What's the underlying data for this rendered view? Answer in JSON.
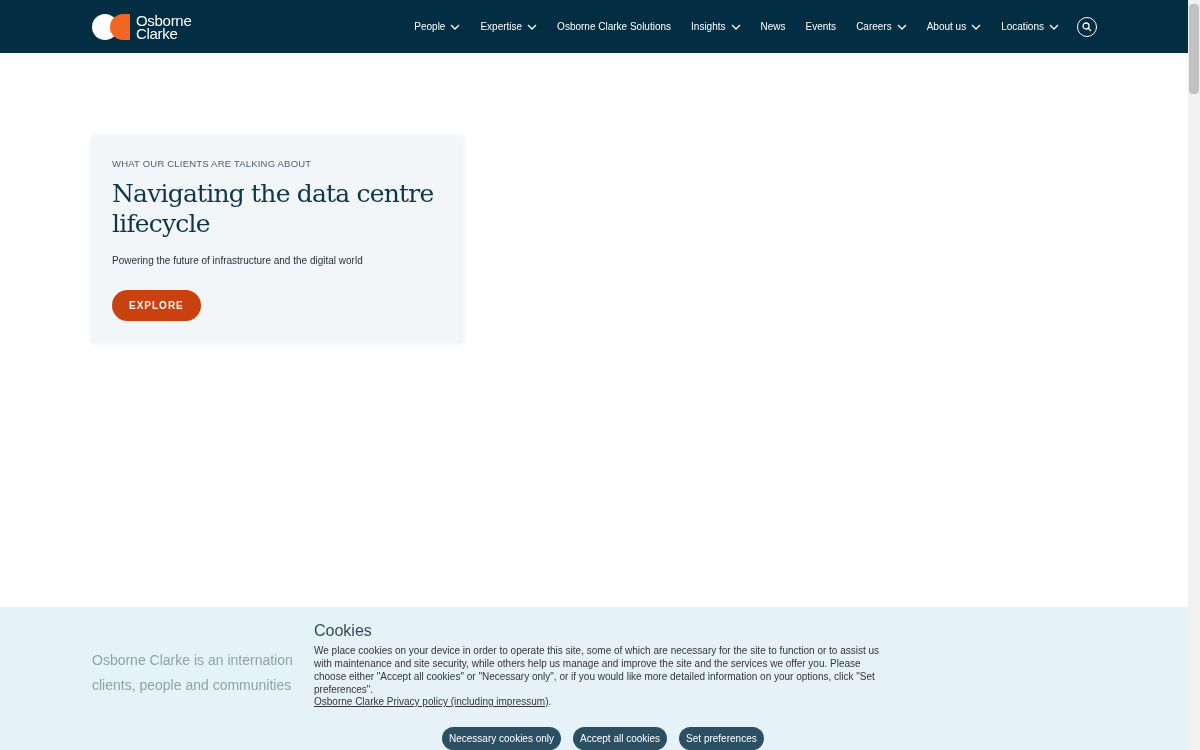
{
  "header": {
    "logo_text": [
      "Osborne",
      "Clarke"
    ],
    "nav": [
      {
        "label": "People",
        "dropdown": true
      },
      {
        "label": "Expertise",
        "dropdown": true
      },
      {
        "label": "Osborne Clarke Solutions",
        "dropdown": false
      },
      {
        "label": "Insights",
        "dropdown": true
      },
      {
        "label": "News",
        "dropdown": false
      },
      {
        "label": "Events",
        "dropdown": false
      },
      {
        "label": "Careers",
        "dropdown": true
      },
      {
        "label": "About us",
        "dropdown": true
      },
      {
        "label": "Locations",
        "dropdown": true
      }
    ]
  },
  "hero": {
    "eyebrow": "WHAT OUR CLIENTS ARE TALKING ABOUT",
    "title": "Navigating the data centre lifecycle",
    "subtitle": "Powering the future of infrastructure and the digital world",
    "button": "EXPLORE"
  },
  "intro_fragments": [
    "Osborne Clarke is an internation",
    "clients, people and communities"
  ],
  "cookie_banner": {
    "title": "Cookies",
    "text": "We place cookies on your device in order to operate this site, some of which are necessary for the site to function or to assist us with maintenance and site security, while others help us manage and improve the site and the services we offer you. Please choose either \"Accept all cookies\" or \"Necessary only\", or if you would like more detailed information on your options, click \"Set preferences\".",
    "link": "Osborne Clarke Privacy policy (including impressum)",
    "link_suffix": ".",
    "buttons": [
      "Necessary cookies only",
      "Accept all cookies",
      "Set preferences"
    ]
  }
}
